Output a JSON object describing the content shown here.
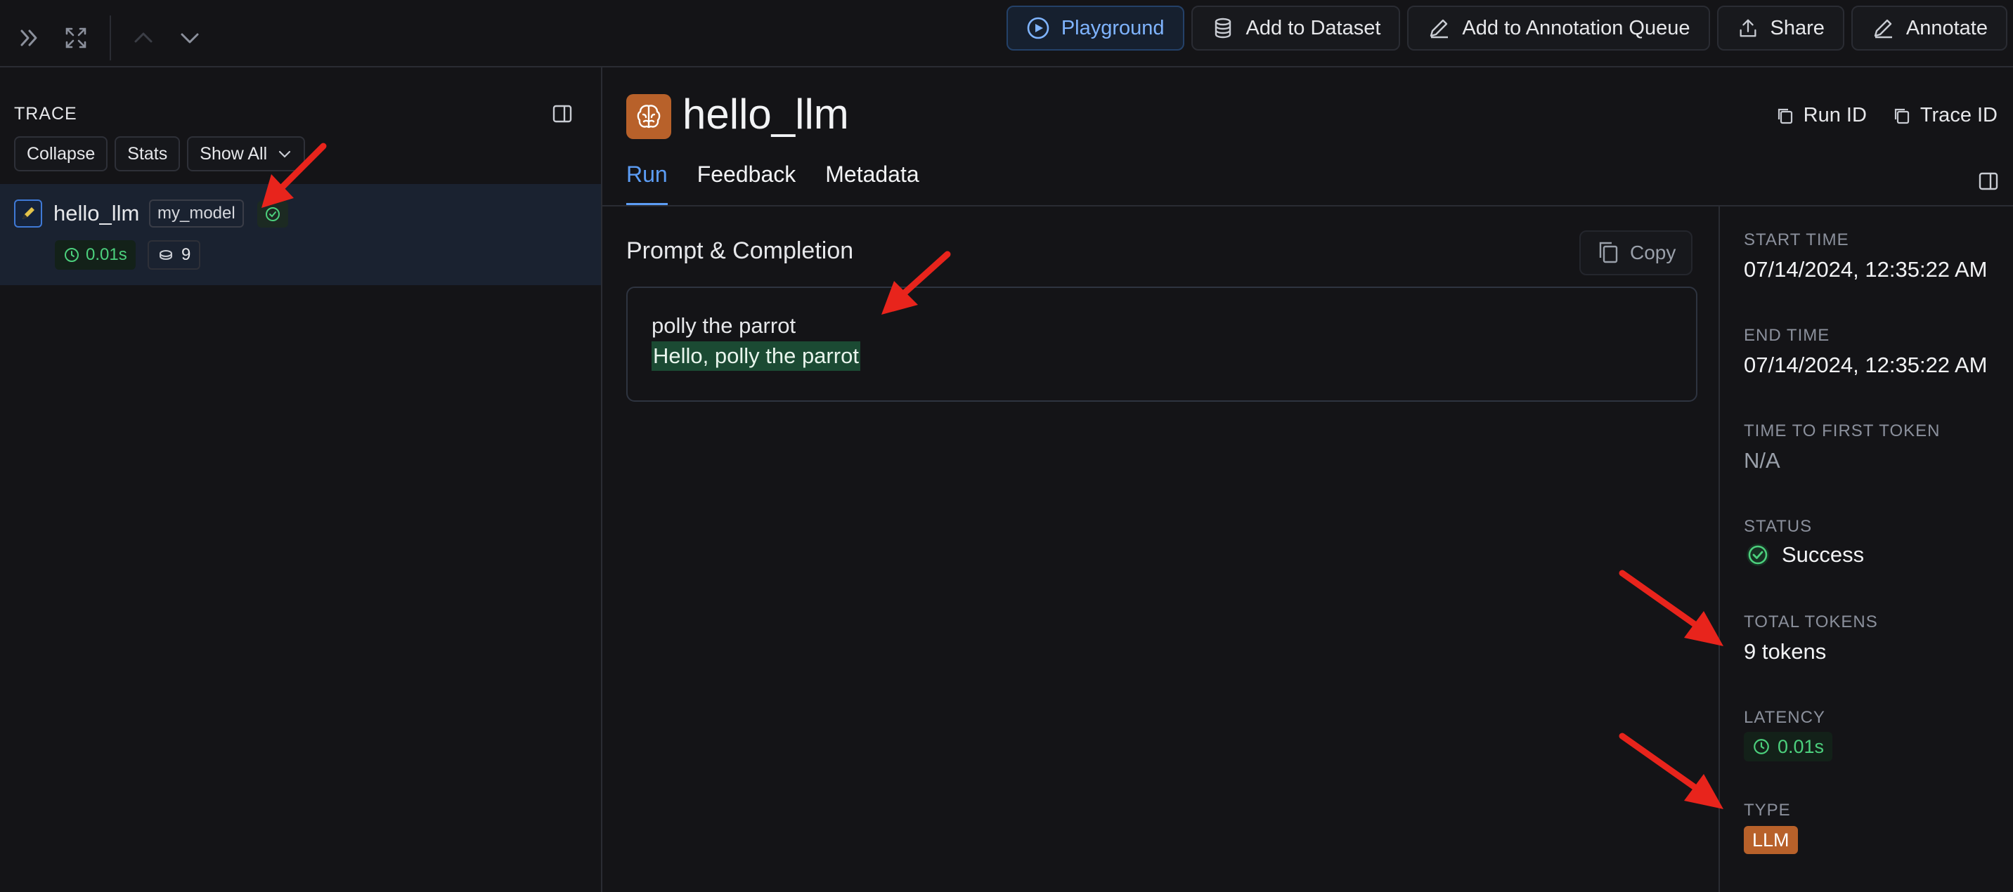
{
  "toolbar": {
    "playground": "Playground",
    "add_to_dataset": "Add to Dataset",
    "add_to_annotation_queue": "Add to Annotation Queue",
    "share": "Share",
    "annotate": "Annotate"
  },
  "trace": {
    "label": "TRACE",
    "collapse": "Collapse",
    "stats": "Stats",
    "show_all": "Show All",
    "run": {
      "name": "hello_llm",
      "model": "my_model",
      "latency": "0.01s",
      "tokens": "9"
    }
  },
  "run": {
    "title": "hello_llm",
    "run_id_label": "Run ID",
    "trace_id_label": "Trace ID",
    "tabs": [
      "Run",
      "Feedback",
      "Metadata"
    ],
    "active_tab": "Run"
  },
  "prompt_completion": {
    "title": "Prompt & Completion",
    "copy_label": "Copy",
    "prompt": "polly the parrot",
    "completion": "Hello, polly the parrot"
  },
  "details": {
    "start_time_label": "START TIME",
    "start_time": "07/14/2024, 12:35:22 AM",
    "end_time_label": "END TIME",
    "end_time": "07/14/2024, 12:35:22 AM",
    "ttft_label": "TIME TO FIRST TOKEN",
    "ttft": "N/A",
    "status_label": "STATUS",
    "status": "Success",
    "total_tokens_label": "TOTAL TOKENS",
    "total_tokens": "9 tokens",
    "latency_label": "LATENCY",
    "latency": "0.01s",
    "type_label": "TYPE",
    "type": "LLM"
  },
  "colors": {
    "accent": "#5c9df5",
    "success": "#4cd07d",
    "llm_badge": "#b8612a",
    "annotation_arrow": "#e8241c"
  }
}
